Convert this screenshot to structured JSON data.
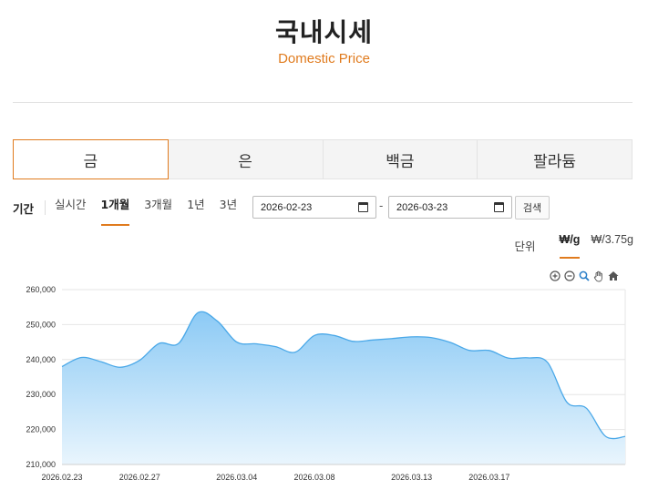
{
  "header": {
    "title": "국내시세",
    "subtitle": "Domestic Price"
  },
  "tabs": [
    {
      "label": "금",
      "active": true
    },
    {
      "label": "은",
      "active": false
    },
    {
      "label": "백금",
      "active": false
    },
    {
      "label": "팔라듐",
      "active": false
    }
  ],
  "filters": {
    "label": "기간",
    "periods": [
      "실시간",
      "1개월",
      "3개월",
      "1년",
      "3년"
    ],
    "active_period": "1개월",
    "start_date": "2026-02-23",
    "end_date": "2026-03-23",
    "separator": "-",
    "search_label": "검색"
  },
  "units": {
    "label": "단위",
    "options": [
      "₩/g",
      "₩/3.75g"
    ],
    "active": "₩/g"
  },
  "colors": {
    "accent": "#e07b1e",
    "line": "#4aa8e8",
    "fill_top": "#8ccaf5",
    "fill_bottom": "#e9f5fd"
  },
  "chart_data": {
    "type": "area",
    "x_tick_labels": [
      "2026.02.23",
      "2026.02.27",
      "2026.03.04",
      "2026.03.08",
      "2026.03.13",
      "2026.03.17"
    ],
    "ylim": [
      210000,
      260000
    ],
    "y_ticks": [
      210000,
      220000,
      230000,
      240000,
      250000,
      260000
    ],
    "y_tick_labels": [
      "210,000",
      "220,000",
      "230,000",
      "240,000",
      "250,000",
      "260,000"
    ],
    "grid": true,
    "values": [
      238000,
      240600,
      239400,
      237800,
      239800,
      244600,
      244600,
      253400,
      251000,
      245000,
      244500,
      243700,
      242100,
      246900,
      246900,
      245200,
      245600,
      246000,
      246500,
      246300,
      244900,
      242600,
      242600,
      240400,
      240500,
      239200,
      227800,
      226100,
      218000,
      218000
    ]
  }
}
